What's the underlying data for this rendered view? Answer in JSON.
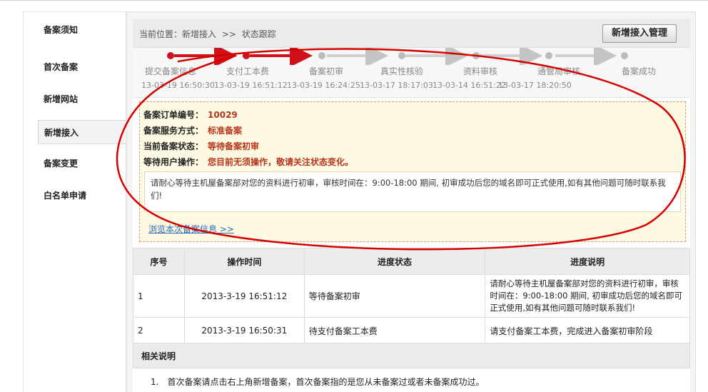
{
  "sidebar": {
    "items": [
      {
        "label": "备案须知"
      },
      {
        "label": "首次备案"
      },
      {
        "label": "新增网站"
      },
      {
        "label": "新增接入"
      },
      {
        "label": "备案变更"
      },
      {
        "label": "白名单申请"
      }
    ],
    "active_index": 3
  },
  "breadcrumb": {
    "prefix": "当前位置：新增接入",
    "separator": ">>",
    "current": "状态跟踪"
  },
  "manage_button": "新增接入管理",
  "steps": [
    {
      "label": "提交备案信息",
      "time": "13-03-19 16:50:30",
      "done": true
    },
    {
      "label": "支付工本费",
      "time": "13-03-19 16:51:12",
      "done": true
    },
    {
      "label": "备案初审",
      "time": "13-03-19 16:24:25",
      "done": false
    },
    {
      "label": "真实性核验",
      "time": "13-03-17 18:17:03",
      "done": false
    },
    {
      "label": "资料审核",
      "time": "13-03-14 16:51:22",
      "done": false
    },
    {
      "label": "通管局审核",
      "time": "13-03-17 18:20:50",
      "done": false
    },
    {
      "label": "备案成功",
      "time": "",
      "done": false
    }
  ],
  "info": {
    "order_label": "备案订单编号：",
    "order_value": "10029",
    "method_label": "备案服务方式：",
    "method_value": "标准备案",
    "status_label": "当前备案状态：",
    "status_value": "等待备案初审",
    "op_label": "等待用户操作：",
    "op_value": "您目前无须操作，敬请关注状态变化。",
    "notice": "请耐心等待主机屋备案部对您的资料进行初审，审核时间在：9:00-18:00 期间, 初审成功后您的域名即可正式使用,如有其他问题可随时联系我们!",
    "browse_link": "浏览本次备案信息 >>"
  },
  "table": {
    "headers": [
      "序号",
      "操作时间",
      "进度状态",
      "进度说明"
    ],
    "rows": [
      {
        "no": "1",
        "time": "2013-3-19 16:51:12",
        "status": "等待备案初审",
        "desc": "请耐心等待主机屋备案部对您的资料进行初审，审核时间在：9:00-18:00 期间, 初审成功后您的域名即可正式使用,如有其他问题可随时联系我们!"
      },
      {
        "no": "2",
        "time": "2013-3-19 16:50:31",
        "status": "待支付备案工本费",
        "desc": "请支付备案工本费，完成进入备案初审阶段"
      }
    ]
  },
  "related": {
    "title": "相关说明",
    "items": [
      {
        "num": "1.",
        "text": "首次备案请点击右上角新增备案，首次备案指的是您从未备案过或者未备案成功过。"
      }
    ]
  },
  "colors": {
    "done": "#d0101a",
    "pending": "#bbbbbb",
    "highlight": "#b8341b",
    "annotation": "#d40000"
  }
}
